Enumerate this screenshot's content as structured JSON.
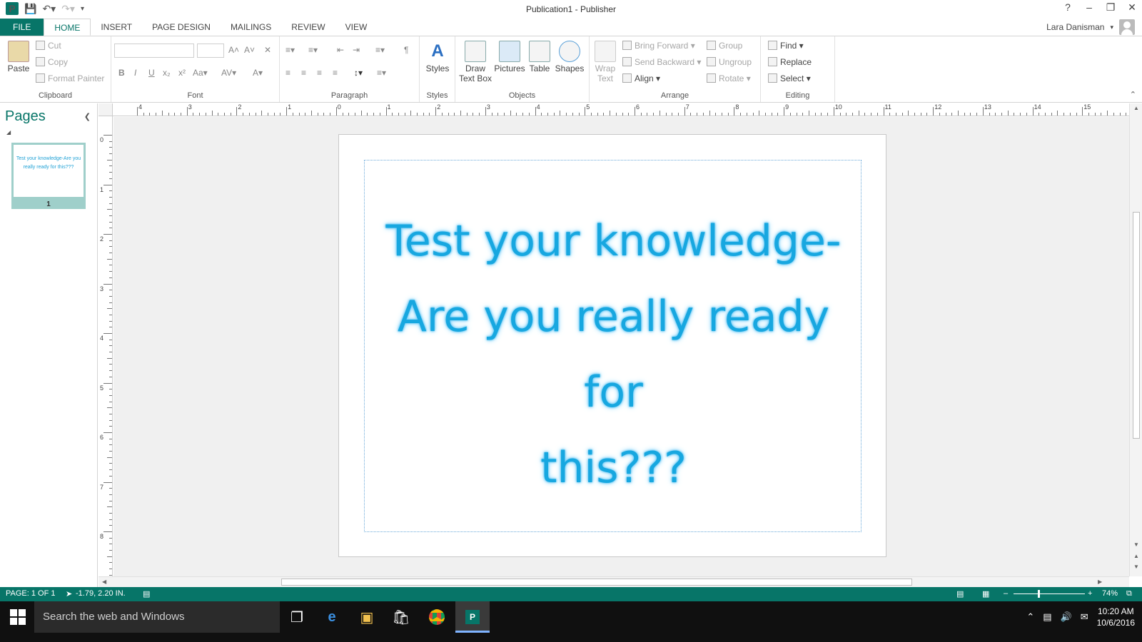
{
  "app": {
    "title": "Publication1 - Publisher",
    "logo_letter": "P",
    "user_name": "Lara Danisman",
    "help_label": "?"
  },
  "tabs": [
    "FILE",
    "HOME",
    "INSERT",
    "PAGE DESIGN",
    "MAILINGS",
    "REVIEW",
    "VIEW"
  ],
  "active_tab": "HOME",
  "ribbon": {
    "clipboard": {
      "label": "Clipboard",
      "paste": "Paste",
      "cut": "Cut",
      "copy": "Copy",
      "format_painter": "Format Painter"
    },
    "font": {
      "label": "Font"
    },
    "paragraph": {
      "label": "Paragraph"
    },
    "styles": {
      "label": "Styles",
      "styles_btn": "Styles"
    },
    "objects": {
      "label": "Objects",
      "draw_text_box_1": "Draw",
      "draw_text_box_2": "Text Box",
      "pictures": "Pictures",
      "table": "Table",
      "shapes": "Shapes"
    },
    "arrange": {
      "label": "Arrange",
      "wrap_text_1": "Wrap",
      "wrap_text_2": "Text",
      "bring_forward": "Bring Forward",
      "send_backward": "Send Backward",
      "align": "Align",
      "group": "Group",
      "ungroup": "Ungroup",
      "rotate": "Rotate"
    },
    "editing": {
      "label": "Editing",
      "find": "Find",
      "replace": "Replace",
      "select": "Select"
    }
  },
  "pages_panel": {
    "title": "Pages",
    "thumb_text": "Test your knowledge-Are you really ready for this???",
    "page_number": "1"
  },
  "ruler_h": [
    "4",
    "3",
    "2",
    "1",
    "0",
    "1",
    "2",
    "3",
    "4",
    "5",
    "6",
    "7",
    "8",
    "9",
    "10",
    "11",
    "12",
    "13",
    "14",
    "15"
  ],
  "ruler_v": [
    "0",
    "1",
    "2",
    "3",
    "4",
    "5",
    "6",
    "7",
    "8"
  ],
  "page": {
    "line1": "Test your knowledge-",
    "line2": "Are you really ready for",
    "line3": "this???"
  },
  "status": {
    "page": "PAGE: 1 OF 1",
    "position": "-1.79, 2.20 IN.",
    "zoom": "74%"
  },
  "taskbar": {
    "search_placeholder": "Search the web and Windows",
    "time": "10:20 AM",
    "date": "10/6/2016"
  },
  "colors": {
    "accent": "#077568",
    "headline": "#17a7e0"
  }
}
